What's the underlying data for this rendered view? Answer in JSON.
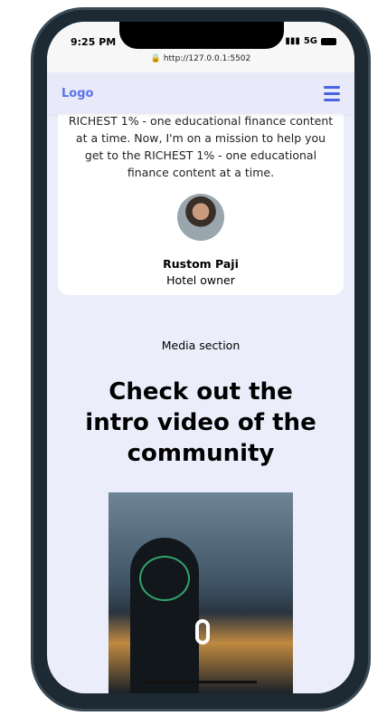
{
  "status": {
    "time": "9:25 PM",
    "network": "5G",
    "url": "http://127.0.0.1:5502"
  },
  "nav": {
    "logo": "Logo"
  },
  "testimonial": {
    "quote": "RICHEST 1% - one educational finance content at a time. Now, I'm on a mission to help you get to the RICHEST 1% - one educational finance content at a time.",
    "name": "Rustom Paji",
    "role": "Hotel owner"
  },
  "media": {
    "label": "Media section",
    "heading": "Check out the intro video of the community"
  }
}
